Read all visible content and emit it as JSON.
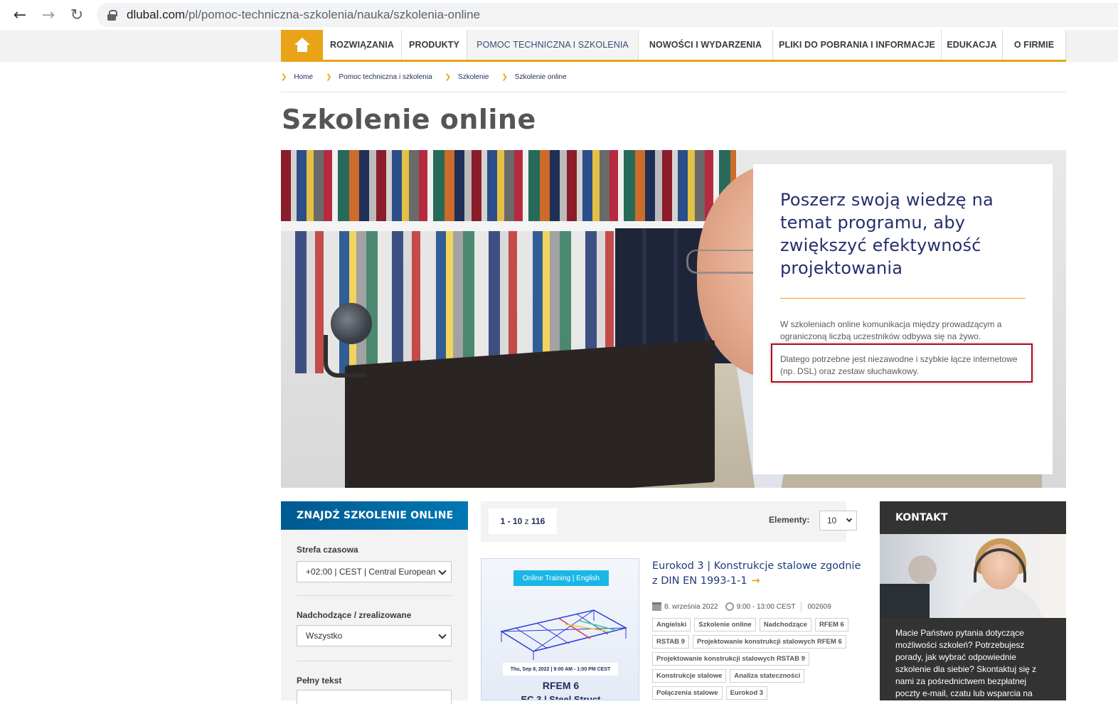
{
  "browser": {
    "url_host": "dlubal.com",
    "url_path": "/pl/pomoc-techniczna-szkolenia/nauka/szkolenia-online"
  },
  "topnav": {
    "items": [
      {
        "label": "ROZWIĄZANIA"
      },
      {
        "label": "PRODUKTY"
      },
      {
        "label": "POMOC TECHNICZNA I SZKOLENIA"
      },
      {
        "label": "NOWOŚCI I WYDARZENIA"
      },
      {
        "label": "PLIKI DO POBRANIA I INFORMACJE"
      },
      {
        "label": "EDUKACJA"
      },
      {
        "label": "O FIRMIE"
      }
    ]
  },
  "breadcrumb": [
    "Home",
    "Pomoc techniczna i szkolenia",
    "Szkolenie",
    "Szkolenie online"
  ],
  "page_title": "Szkolenie online",
  "hero": {
    "heading": "Poszerz swoją wiedzę na temat programu, aby zwiększyć efektywność projektowania",
    "paragraph1": "W szkoleniach online komunikacja między prowadzącym a ograniczoną liczbą uczestników odbywa się na żywo.",
    "paragraph2": "Dlatego potrzebne jest niezawodne i szybkie łącze internetowe (np. DSL) oraz zestaw słuchawkowy.",
    "highlight_color": "#a4121f"
  },
  "filter": {
    "title": "ZNAJDŹ SZKOLENIE ONLINE",
    "timezone_label": "Strefa czasowa",
    "timezone_value": "+02:00 | CEST | Central European",
    "upcoming_label": "Nadchodzące / zrealizowane",
    "upcoming_value": "Wszystko",
    "fulltext_label": "Pełny tekst"
  },
  "results": {
    "range": "1 - 10",
    "of": "z",
    "total": "116",
    "elements_label": "Elementy:",
    "elements_value": "10"
  },
  "course": {
    "thumb_tag": "Online Training | English",
    "thumb_date": "Thu, Sep 8, 2022 | 9:00 AM - 1:00 PM CEST",
    "thumb_title": "RFEM 6",
    "thumb_sub": "EC 3 | Steel Struct",
    "title": "Eurokod 3 | Konstrukcje stalowe zgodnie z DIN EN 1993-1-1",
    "date": "8. września 2022",
    "time": "9:00 - 13:00 CEST",
    "code": "002609",
    "tags": [
      "Angielski",
      "Szkolenie online",
      "Nadchodzące",
      "RFEM 6",
      "RSTAB 9",
      "Projektowanie konstrukcji stalowych RFEM 6",
      "Projektowanie konstrukcji stalowych RSTAB 9",
      "Konstrukcje stalowe",
      "Analiza stateczności",
      "Połączenia stalowe",
      "Eurokod 3"
    ]
  },
  "contact": {
    "title": "KONTAKT",
    "text": "Macie Państwo pytania dotyczące możliwości szkoleń? Potrzebujesz porady, jak wybrać odpowiednie szkolenie dla siebie? Skontaktuj się z nami za pośrednictwem bezpłatnej poczty e-mail, czatu lub wsparcia na"
  },
  "colors": {
    "accent": "#e8a317",
    "navy": "#252f6b",
    "filter_blue": "#0077b3"
  }
}
